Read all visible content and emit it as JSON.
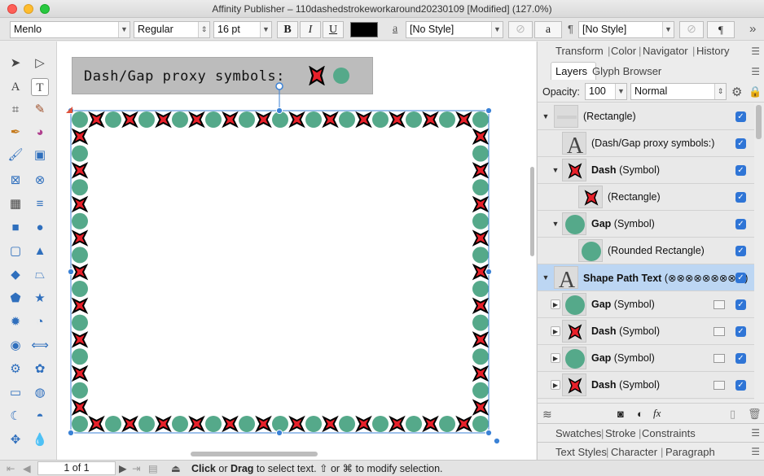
{
  "window": {
    "title": "Affinity Publisher – 110dashedstrokeworkaround20230109 [Modified] (127.0%)"
  },
  "context_toolbar": {
    "font_family": "Menlo",
    "font_style": "Regular",
    "font_size": "16 pt",
    "bold": "B",
    "italic": "I",
    "underline": "U",
    "text_color": "#000000",
    "char_style": "[No Style]",
    "para_style": "[No Style]",
    "char_glyph": "a",
    "para_glyph": "¶",
    "more": "»"
  },
  "canvas": {
    "proxy_text": "Dash/Gap proxy symbols:",
    "dash_color": "#e8202a",
    "gap_color": "#55a98a"
  },
  "panel_top": {
    "tabs": [
      "Transform",
      "Color",
      "Navigator",
      "History"
    ]
  },
  "panel_layers": {
    "tabs": [
      "Layers",
      "Glyph Browser"
    ],
    "opacity_label": "Opacity:",
    "opacity_value": "100",
    "blend_mode": "Normal",
    "rows": [
      {
        "name": "",
        "type": "(Rectangle)",
        "bold": false,
        "indent": 0,
        "expanded": true,
        "thumb": "rect"
      },
      {
        "name": "",
        "type": "(Dash/Gap proxy symbols:)",
        "bold": false,
        "indent": 1,
        "expanded": null,
        "thumb": "text"
      },
      {
        "name": "Dash",
        "type": "(Symbol)",
        "bold": true,
        "indent": 1,
        "expanded": true,
        "thumb": "dash"
      },
      {
        "name": "",
        "type": "(Rectangle)",
        "bold": false,
        "indent": 2,
        "expanded": null,
        "thumb": "dash"
      },
      {
        "name": "Gap",
        "type": "(Symbol)",
        "bold": true,
        "indent": 1,
        "expanded": true,
        "thumb": "gap"
      },
      {
        "name": "",
        "type": "(Rounded Rectangle)",
        "bold": false,
        "indent": 2,
        "expanded": null,
        "thumb": "gap"
      },
      {
        "name": "Shape Path Text",
        "type": "(⊗⊗⊗⊗⊗⊗⊗⊗⊗)",
        "bold": true,
        "indent": 0,
        "expanded": true,
        "thumb": "text",
        "selected": true
      },
      {
        "name": "Gap",
        "type": "(Symbol)",
        "bold": true,
        "indent": 1,
        "expanded": false,
        "thumb": "gap",
        "fx": true
      },
      {
        "name": "Dash",
        "type": "(Symbol)",
        "bold": true,
        "indent": 1,
        "expanded": false,
        "thumb": "dash",
        "fx": true
      },
      {
        "name": "Gap",
        "type": "(Symbol)",
        "bold": true,
        "indent": 1,
        "expanded": false,
        "thumb": "gap",
        "fx": true
      },
      {
        "name": "Dash",
        "type": "(Symbol)",
        "bold": true,
        "indent": 1,
        "expanded": false,
        "thumb": "dash",
        "fx": true
      }
    ]
  },
  "panel_swatches": {
    "tabs": [
      "Swatches",
      "Stroke",
      "Constraints"
    ]
  },
  "panel_text": {
    "tabs": [
      "Text Styles",
      "Character",
      "Paragraph"
    ]
  },
  "status": {
    "page": "1 of 1",
    "hint_click": "Click",
    "hint_or": " or ",
    "hint_drag": "Drag",
    "hint_rest": " to select text. ⇧ or ⌘ to modify selection."
  }
}
